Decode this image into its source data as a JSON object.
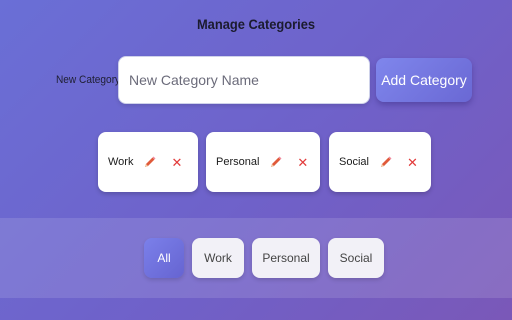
{
  "page": {
    "title": "Manage Categories"
  },
  "form": {
    "label": "New Category:",
    "input_placeholder": "New Category Name",
    "input_value": "",
    "add_button_label": "Add Category"
  },
  "categories": [
    {
      "name": "Work",
      "edit_icon": "pencil-icon",
      "delete_icon": "close-icon",
      "delete_glyph": "✕"
    },
    {
      "name": "Personal",
      "edit_icon": "pencil-icon",
      "delete_icon": "close-icon",
      "delete_glyph": "✕"
    },
    {
      "name": "Social",
      "edit_icon": "pencil-icon",
      "delete_icon": "close-icon",
      "delete_glyph": "✕"
    }
  ],
  "filters": {
    "active": "All",
    "items": [
      "All",
      "Work",
      "Personal",
      "Social"
    ]
  },
  "colors": {
    "accent": "#6f6ae0",
    "delete": "#e23b3b",
    "pencil": "#e05a3a"
  }
}
